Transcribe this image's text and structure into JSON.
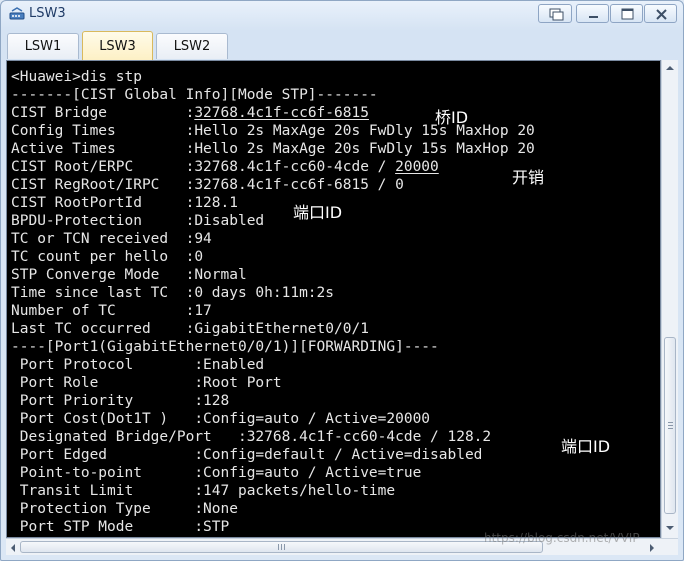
{
  "window": {
    "title": "LSW3"
  },
  "tabs": [
    {
      "label": "LSW1"
    },
    {
      "label": "LSW3"
    },
    {
      "label": "LSW2"
    }
  ],
  "terminal": {
    "lines": [
      "<Huawei>dis stp",
      "-------[CIST Global Info][Mode STP]-------",
      "CIST Bridge         :",
      "Config Times        :Hello 2s MaxAge 20s FwDly 15s MaxHop 20",
      "Active Times        :Hello 2s MaxAge 20s FwDly 15s MaxHop 20",
      "CIST Root/ERPC      :32768.4c1f-cc60-4cde / ",
      "CIST RegRoot/IRPC   :32768.4c1f-cc6f-6815 / 0",
      "CIST RootPortId     :128.1",
      "BPDU-Protection     :Disabled",
      "TC or TCN received  :94",
      "TC count per hello  :0",
      "STP Converge Mode   :Normal",
      "Time since last TC  :0 days 0h:11m:2s",
      "Number of TC        :17",
      "Last TC occurred    :GigabitEthernet0/0/1",
      "----[Port1(GigabitEthernet0/0/1)][FORWARDING]----",
      " Port Protocol       :Enabled",
      " Port Role           :Root Port",
      " Port Priority       :128",
      " Port Cost(Dot1T )   :Config=auto / Active=20000",
      " Designated Bridge/Port   :32768.4c1f-cc60-4cde / 128.2",
      " Port Edged          :Config=default / Active=disabled",
      " Point-to-point      :Config=auto / Active=true",
      " Transit Limit       :147 packets/hello-time",
      " Protection Type     :None",
      " Port STP Mode       :STP"
    ],
    "underlined": {
      "bridge_value": "32768.4c1f-cc6f-6815",
      "root_cost": "20000"
    }
  },
  "annotations": {
    "bridge_id": "桥ID",
    "cost": "开销",
    "port_id_1": "端口ID",
    "port_id_2": "端口ID"
  },
  "watermark": "https://blog.csdn.net/VVIP"
}
